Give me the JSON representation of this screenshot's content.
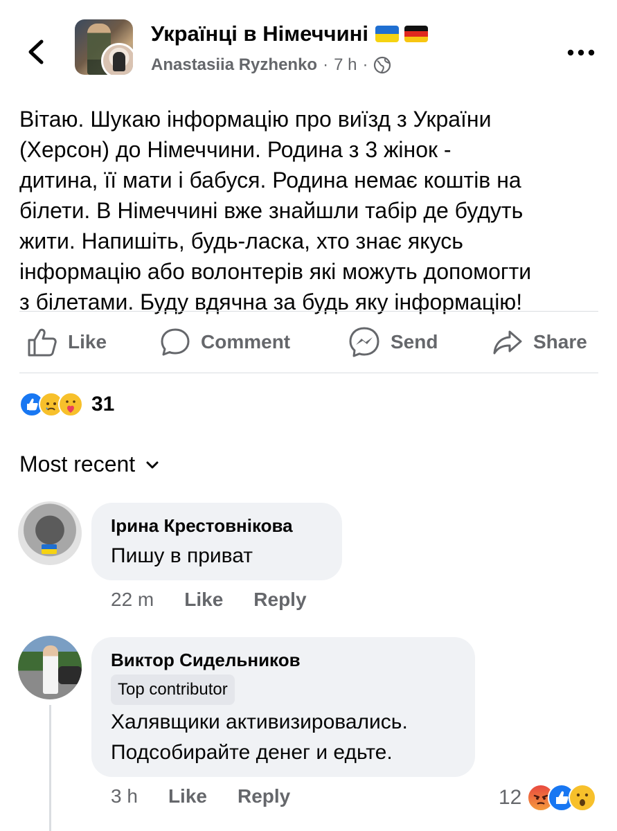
{
  "header": {
    "group_name": "Українці в Німеччині",
    "author": "Anastasiia Ryzhenko",
    "time": "7 h",
    "separator": "·",
    "audience_icon": "globe-icon",
    "back_icon": "chevron-left-icon",
    "more_icon": "more-horizontal-icon"
  },
  "post": {
    "text_lines": [
      "Вітаю. Шукаю інформацію про виїзд з України",
      "(Херсон)  до Німеччини. Родина з 3 жінок -",
      "дитина, її мати і бабуся. Родина немає коштів на",
      "білети. В Німеччині вже знайшли табір де будуть",
      "жити. Напишіть, будь-ласка, хто знає якусь",
      "інформацію або волонтерів які можуть допомогти",
      "з білетами. Буду вдячна за будь яку інформацію!"
    ]
  },
  "actions": {
    "like": "Like",
    "comment": "Comment",
    "send": "Send",
    "share": "Share"
  },
  "reactions": {
    "icons": [
      "like-reaction-icon",
      "sad-reaction-icon",
      "care-reaction-icon"
    ],
    "count": "31"
  },
  "comments_sort": {
    "label": "Most recent",
    "icon": "chevron-down-icon"
  },
  "comments": [
    {
      "author": "Ірина Крестовнікова",
      "text": "Пишу в приват",
      "time": "22 m",
      "like_label": "Like",
      "reply_label": "Reply"
    },
    {
      "author": "Виктор Сидельников",
      "badge": "Top contributor",
      "text_lines": [
        "Халявщики активизировались.",
        "Подсобирайте денег и едьте."
      ],
      "time": "3 h",
      "like_label": "Like",
      "reply_label": "Reply",
      "reaction_count": "12",
      "reaction_icons": [
        "angry-reaction-icon",
        "like-reaction-icon",
        "wow-reaction-icon"
      ]
    }
  ],
  "colors": {
    "text_primary": "#050505",
    "text_secondary": "#65676b",
    "bubble_bg": "#f0f2f5",
    "like_blue": "#1877f2",
    "divider": "#dadde1"
  }
}
